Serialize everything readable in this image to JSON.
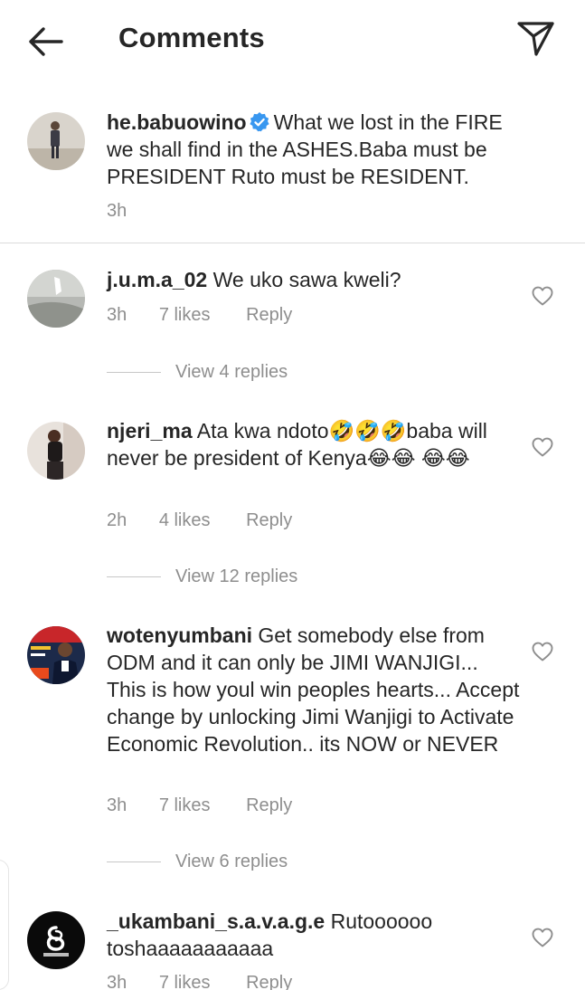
{
  "header": {
    "title": "Comments",
    "back_icon": "arrow-left-icon",
    "send_icon": "paper-plane-icon"
  },
  "caption": {
    "username": "he.babuowino",
    "verified": true,
    "text": "What we lost in the FIRE we shall find in the ASHES.Baba must be PRESIDENT Ruto must be RESIDENT.",
    "time": "3h"
  },
  "comments": [
    {
      "username": "j.u.m.a_02",
      "text": "We uko sawa kweli?",
      "time": "3h",
      "likes": "7 likes",
      "reply": "Reply",
      "view_replies": "View 4 replies"
    },
    {
      "username": "njeri_ma",
      "text_1": "Ata kwa ndoto",
      "text_2": "baba will never be president of Kenya",
      "emoji_rofl": "🤣",
      "emoji_joy": "😂",
      "time": "2h",
      "likes": "4 likes",
      "reply": "Reply",
      "view_replies": "View 12 replies"
    },
    {
      "username": "wotenyumbani",
      "text": "Get somebody else from ODM and it can only be JIMI WANJIGI... This is how youl win peoples hearts... Accept change by unlocking Jimi Wanjigi to Activate Economic Revolution.. its NOW or NEVER",
      "time": "3h",
      "likes": "7 likes",
      "reply": "Reply",
      "view_replies": "View 6 replies"
    },
    {
      "username": "_ukambani_s.a.v.a.g.e",
      "text": "Rutoooooo toshaaaaaaaaaaa",
      "time": "3h",
      "likes": "7 likes",
      "reply": "Reply"
    }
  ],
  "colors": {
    "text": "#262626",
    "secondary": "#8e8e8e",
    "verified": "#3897f0",
    "divider": "#dbdbdb"
  }
}
